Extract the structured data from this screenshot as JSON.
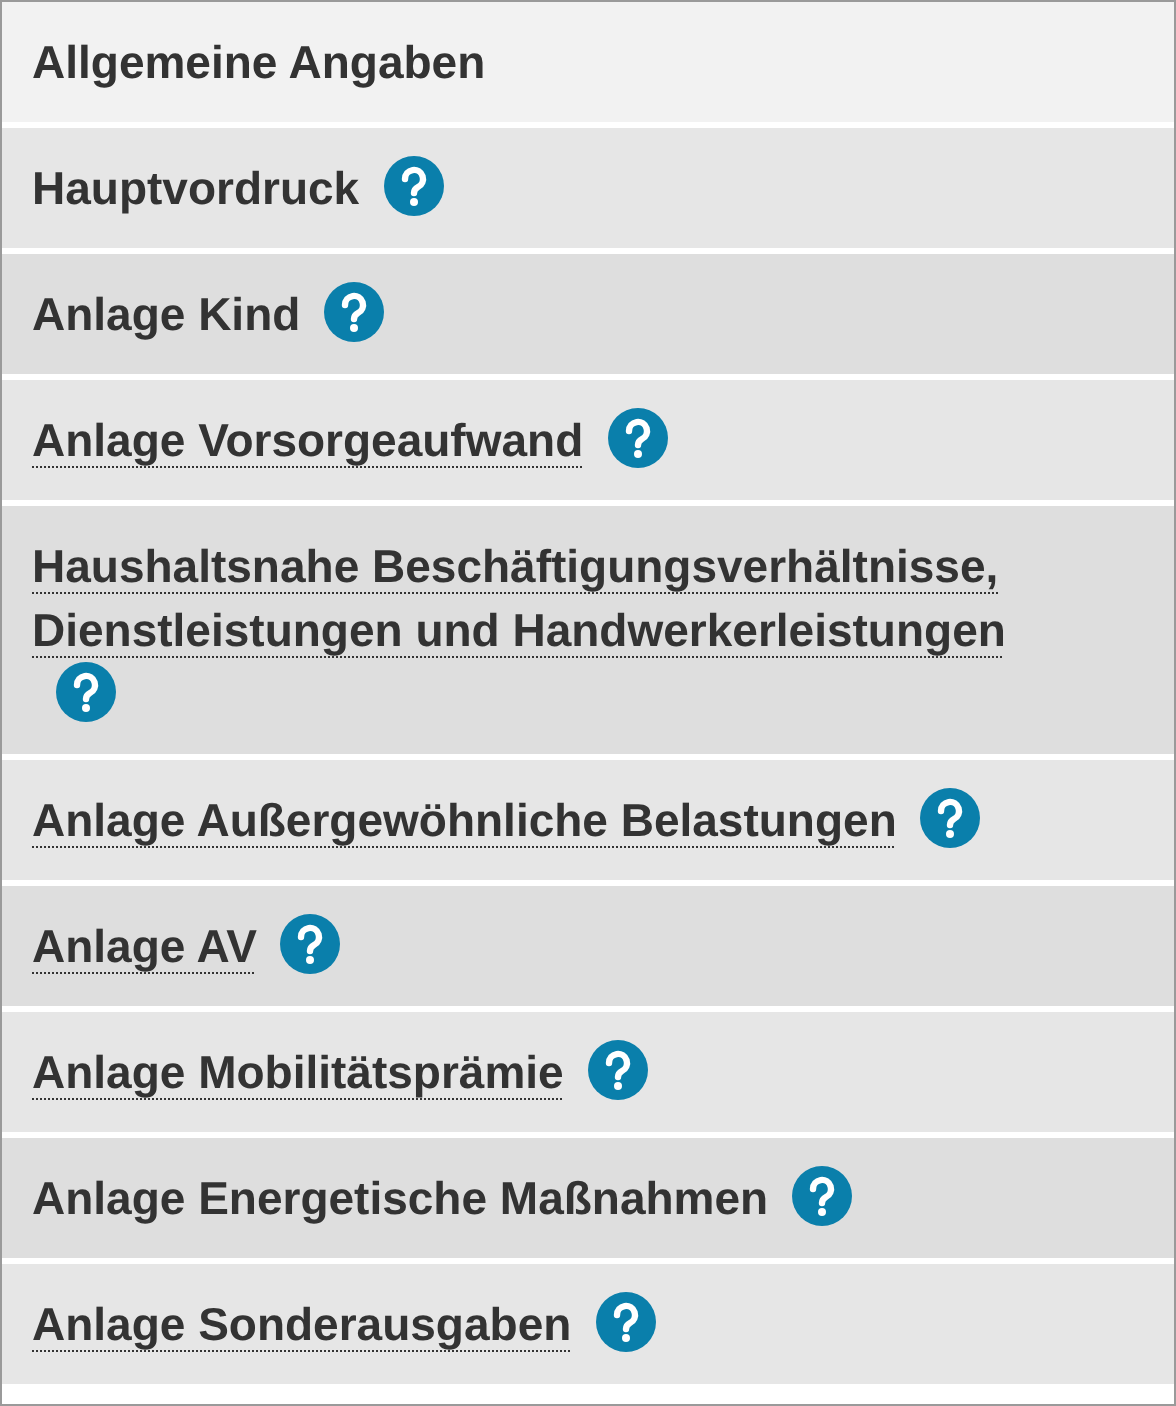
{
  "items": [
    {
      "label": "Allgemeine Angaben",
      "selected": true,
      "underlined": false,
      "help": false
    },
    {
      "label": "Hauptvordruck",
      "selected": false,
      "underlined": false,
      "help": true
    },
    {
      "label": "Anlage Kind",
      "selected": false,
      "underlined": false,
      "help": true
    },
    {
      "label": "Anlage Vorsorgeaufwand",
      "selected": false,
      "underlined": true,
      "help": true
    },
    {
      "label": "Haushaltsnahe Beschäftigungsverhältnisse, Dienstleistungen und Handwerkerleistungen",
      "selected": false,
      "underlined": true,
      "help": true
    },
    {
      "label": "Anlage Außergewöhnliche Belastungen",
      "selected": false,
      "underlined": true,
      "help": true
    },
    {
      "label": "Anlage AV",
      "selected": false,
      "underlined": true,
      "help": true
    },
    {
      "label": "Anlage Mobilitätsprämie",
      "selected": false,
      "underlined": true,
      "help": true
    },
    {
      "label": "Anlage Energetische Maßnahmen",
      "selected": false,
      "underlined": false,
      "help": true
    },
    {
      "label": "Anlage Sonderausgaben",
      "selected": false,
      "underlined": true,
      "help": true
    }
  ]
}
